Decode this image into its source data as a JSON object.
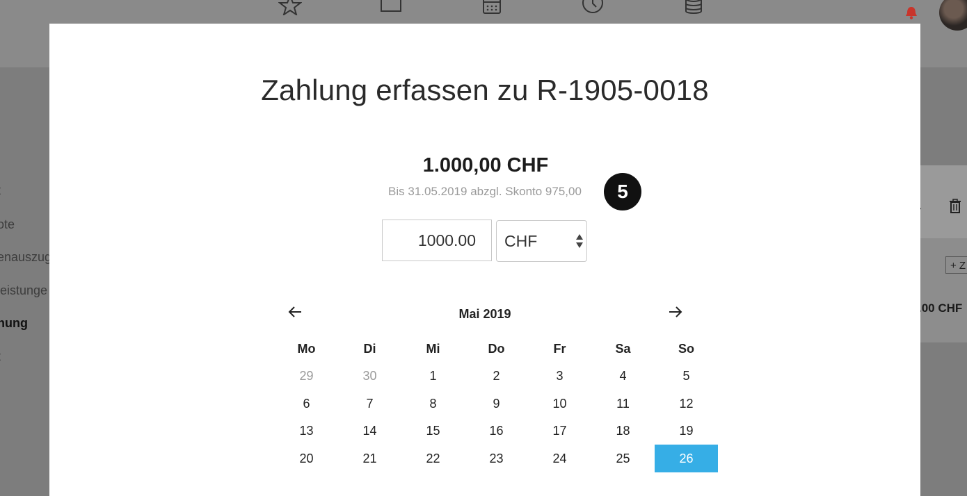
{
  "sidebar": {
    "items": [
      {
        "label": "t"
      },
      {
        "label": "ote"
      },
      {
        "label": "enauszug"
      },
      {
        "label": "leistunge"
      },
      {
        "label": "nung",
        "active": true
      },
      {
        "label": "t"
      }
    ]
  },
  "right_panel": {
    "button_label": "+ Z",
    "amount_partial": ".00 CHF"
  },
  "modal": {
    "title": "Zahlung erfassen zu R-1905-0018",
    "amount": "1.000,00 CHF",
    "skonto_note": "Bis 31.05.2019 abzgl. Skonto 975,00",
    "step_badge": "5",
    "amount_input_value": "1000.00",
    "currency_selected": "CHF",
    "calendar": {
      "month_label": "Mai 2019",
      "weekdays": [
        "Mo",
        "Di",
        "Mi",
        "Do",
        "Fr",
        "Sa",
        "So"
      ],
      "weeks": [
        [
          "29",
          "30",
          "1",
          "2",
          "3",
          "4",
          "5"
        ],
        [
          "6",
          "7",
          "8",
          "9",
          "10",
          "11",
          "12"
        ],
        [
          "13",
          "14",
          "15",
          "16",
          "17",
          "18",
          "19"
        ],
        [
          "20",
          "21",
          "22",
          "23",
          "24",
          "25",
          "26"
        ]
      ],
      "muted_days": [
        "29",
        "30"
      ],
      "selected_day": "26",
      "selected_color": "#36aee6"
    }
  },
  "colors": {
    "accent": "#36aee6",
    "bell": "#c8352b"
  },
  "icons": [
    "star-icon",
    "square-icon",
    "calendar-icon",
    "clock-icon",
    "database-icon",
    "bell-icon",
    "trash-icon",
    "arrow-left-icon",
    "arrow-right-icon",
    "select-arrows-icon"
  ]
}
